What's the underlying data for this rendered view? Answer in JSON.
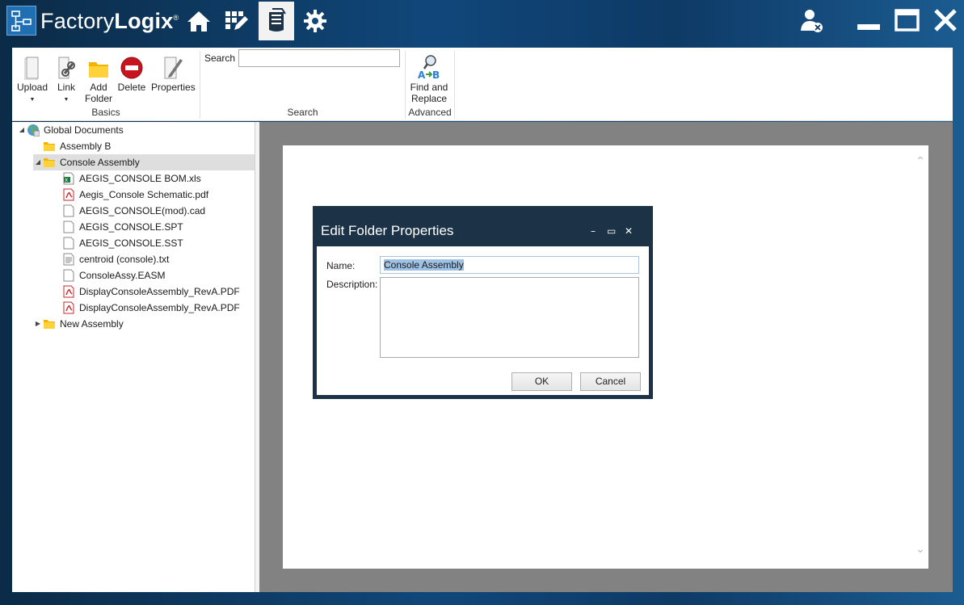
{
  "app": {
    "name_light": "Factory",
    "name_bold": "Logix",
    "trademark": "®"
  },
  "nav": [
    {
      "name": "home-icon"
    },
    {
      "name": "grid-edit-icon"
    },
    {
      "name": "documents-icon",
      "active": true
    },
    {
      "name": "gear-icon"
    }
  ],
  "ribbon": {
    "basics": {
      "group_label": "Basics",
      "upload_label": "Upload",
      "link_label": "Link",
      "add_folder_line1": "Add",
      "add_folder_line2": "Folder",
      "delete_label": "Delete",
      "properties_label": "Properties"
    },
    "search": {
      "label": "Search",
      "value": "",
      "group_label": "Search"
    },
    "advanced": {
      "find_line1": "Find and",
      "find_line2": "Replace",
      "group_label": "Advanced"
    }
  },
  "tree": {
    "root": "Global Documents",
    "items": [
      {
        "label": "Assembly B",
        "type": "folder"
      },
      {
        "label": "Console Assembly",
        "type": "folder",
        "selected": true
      },
      {
        "label": "AEGIS_CONSOLE BOM.xls",
        "type": "excel"
      },
      {
        "label": "Aegis_Console Schematic.pdf",
        "type": "pdf"
      },
      {
        "label": "AEGIS_CONSOLE(mod).cad",
        "type": "file"
      },
      {
        "label": "AEGIS_CONSOLE.SPT",
        "type": "file"
      },
      {
        "label": "AEGIS_CONSOLE.SST",
        "type": "file"
      },
      {
        "label": "centroid (console).txt",
        "type": "text"
      },
      {
        "label": "ConsoleAssy.EASM",
        "type": "file"
      },
      {
        "label": "DisplayConsoleAssembly_RevA.PDF",
        "type": "pdf"
      },
      {
        "label": "DisplayConsoleAssembly_RevA.PDF",
        "type": "pdf"
      },
      {
        "label": "New Assembly",
        "type": "folder"
      }
    ]
  },
  "dialog": {
    "title": "Edit Folder Properties",
    "name_label": "Name:",
    "name_value": "Console Assembly",
    "description_label": "Description:",
    "description_value": "",
    "ok_label": "OK",
    "cancel_label": "Cancel",
    "minimize": "–",
    "maximize": "▭",
    "close": "✕"
  },
  "colors": {
    "titlebar": "#10477a",
    "dialog_frame": "#1c3347",
    "selection": "#9fc2e4"
  }
}
